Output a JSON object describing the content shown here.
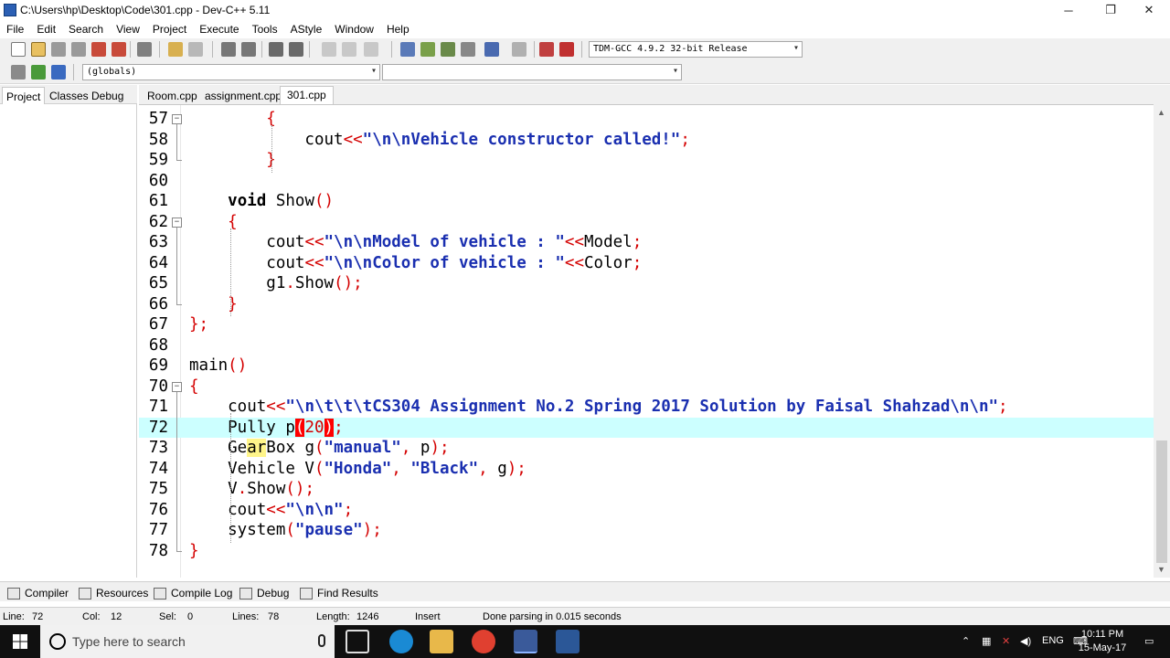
{
  "window": {
    "title": "C:\\Users\\hp\\Desktop\\Code\\301.cpp - Dev-C++ 5.11",
    "minimize_glyph": "─",
    "restore_glyph": "❐",
    "close_glyph": "✕"
  },
  "menu": [
    "File",
    "Edit",
    "Search",
    "View",
    "Project",
    "Execute",
    "Tools",
    "AStyle",
    "Window",
    "Help"
  ],
  "toolbar": {
    "compiler_select": "TDM-GCC 4.9.2 32-bit Release",
    "scope_select": "(globals)",
    "member_select": ""
  },
  "left_tabs": [
    "Project",
    "Classes",
    "Debug"
  ],
  "editor_tabs": [
    "Room.cpp",
    "assignment.cpp",
    "301.cpp"
  ],
  "code_lines": [
    {
      "num": "57",
      "fold": "⊟",
      "tokens": [
        {
          "t": "        ",
          "c": "plain"
        },
        {
          "t": "{",
          "c": "red"
        }
      ]
    },
    {
      "num": "58",
      "fold": "",
      "tokens": [
        {
          "t": "            cout",
          "c": "plain"
        },
        {
          "t": "<<",
          "c": "red"
        },
        {
          "t": "\"\\n\\nVehicle constructor called!\"",
          "c": "blue"
        },
        {
          "t": ";",
          "c": "red"
        }
      ]
    },
    {
      "num": "59",
      "fold": "",
      "tokens": [
        {
          "t": "        ",
          "c": "plain"
        },
        {
          "t": "}",
          "c": "red"
        }
      ]
    },
    {
      "num": "60",
      "fold": "",
      "tokens": []
    },
    {
      "num": "61",
      "fold": "",
      "tokens": [
        {
          "t": "    ",
          "c": "plain"
        },
        {
          "t": "void",
          "c": "kw"
        },
        {
          "t": " Show",
          "c": "plain"
        },
        {
          "t": "()",
          "c": "red"
        }
      ]
    },
    {
      "num": "62",
      "fold": "⊟",
      "tokens": [
        {
          "t": "    ",
          "c": "plain"
        },
        {
          "t": "{",
          "c": "red"
        }
      ]
    },
    {
      "num": "63",
      "fold": "",
      "tokens": [
        {
          "t": "        cout",
          "c": "plain"
        },
        {
          "t": "<<",
          "c": "red"
        },
        {
          "t": "\"\\n\\nModel of vehicle : \"",
          "c": "blue"
        },
        {
          "t": "<<",
          "c": "red"
        },
        {
          "t": "Model",
          "c": "plain"
        },
        {
          "t": ";",
          "c": "red"
        }
      ]
    },
    {
      "num": "64",
      "fold": "",
      "tokens": [
        {
          "t": "        cout",
          "c": "plain"
        },
        {
          "t": "<<",
          "c": "red"
        },
        {
          "t": "\"\\n\\nColor of vehicle : \"",
          "c": "blue"
        },
        {
          "t": "<<",
          "c": "red"
        },
        {
          "t": "Color",
          "c": "plain"
        },
        {
          "t": ";",
          "c": "red"
        }
      ]
    },
    {
      "num": "65",
      "fold": "",
      "tokens": [
        {
          "t": "        g1",
          "c": "plain"
        },
        {
          "t": ".",
          "c": "red"
        },
        {
          "t": "Show",
          "c": "plain"
        },
        {
          "t": "();",
          "c": "red"
        }
      ]
    },
    {
      "num": "66",
      "fold": "",
      "tokens": [
        {
          "t": "    ",
          "c": "plain"
        },
        {
          "t": "}",
          "c": "red"
        }
      ]
    },
    {
      "num": "67",
      "fold": "",
      "tokens": [
        {
          "t": "};",
          "c": "red"
        }
      ]
    },
    {
      "num": "68",
      "fold": "",
      "tokens": []
    },
    {
      "num": "69",
      "fold": "",
      "tokens": [
        {
          "t": "main",
          "c": "plain"
        },
        {
          "t": "()",
          "c": "red"
        }
      ]
    },
    {
      "num": "70",
      "fold": "⊟",
      "tokens": [
        {
          "t": "{",
          "c": "red"
        }
      ]
    },
    {
      "num": "71",
      "fold": "",
      "tokens": [
        {
          "t": "    cout",
          "c": "plain"
        },
        {
          "t": "<<",
          "c": "red"
        },
        {
          "t": "\"\\n\\t\\t\\tCS304 Assignment No.2 Spring 2017 Solution by Faisal Shahzad\\n\\n\"",
          "c": "blue"
        },
        {
          "t": ";",
          "c": "red"
        }
      ]
    },
    {
      "num": "72",
      "fold": "",
      "current": true,
      "tokens": [
        {
          "t": "    Pully p",
          "c": "plain"
        },
        {
          "t": "(",
          "c": "match"
        },
        {
          "t": "20",
          "c": "red"
        },
        {
          "t": ")",
          "c": "match"
        },
        {
          "t": ";",
          "c": "red"
        }
      ]
    },
    {
      "num": "73",
      "fold": "",
      "tokens": [
        {
          "t": "    Ge",
          "c": "plain"
        },
        {
          "t": "ar",
          "c": "hl"
        },
        {
          "t": "Box g",
          "c": "plain"
        },
        {
          "t": "(",
          "c": "red"
        },
        {
          "t": "\"manual\"",
          "c": "blue"
        },
        {
          "t": ", ",
          "c": "red"
        },
        {
          "t": "p",
          "c": "plain"
        },
        {
          "t": ");",
          "c": "red"
        }
      ]
    },
    {
      "num": "74",
      "fold": "",
      "tokens": [
        {
          "t": "    Vehicle V",
          "c": "plain"
        },
        {
          "t": "(",
          "c": "red"
        },
        {
          "t": "\"Honda\"",
          "c": "blue"
        },
        {
          "t": ", ",
          "c": "red"
        },
        {
          "t": "\"Black\"",
          "c": "blue"
        },
        {
          "t": ", ",
          "c": "red"
        },
        {
          "t": "g",
          "c": "plain"
        },
        {
          "t": ");",
          "c": "red"
        }
      ]
    },
    {
      "num": "75",
      "fold": "",
      "tokens": [
        {
          "t": "    V",
          "c": "plain"
        },
        {
          "t": ".",
          "c": "red"
        },
        {
          "t": "Show",
          "c": "plain"
        },
        {
          "t": "();",
          "c": "red"
        }
      ]
    },
    {
      "num": "76",
      "fold": "",
      "tokens": [
        {
          "t": "    cout",
          "c": "plain"
        },
        {
          "t": "<<",
          "c": "red"
        },
        {
          "t": "\"\\n\\n\"",
          "c": "blue"
        },
        {
          "t": ";",
          "c": "red"
        }
      ]
    },
    {
      "num": "77",
      "fold": "",
      "tokens": [
        {
          "t": "    system",
          "c": "plain"
        },
        {
          "t": "(",
          "c": "red"
        },
        {
          "t": "\"pause\"",
          "c": "blue"
        },
        {
          "t": ");",
          "c": "red"
        }
      ]
    },
    {
      "num": "78",
      "fold": "",
      "tokens": [
        {
          "t": "}",
          "c": "red"
        }
      ]
    }
  ],
  "bottom_tabs": [
    "Compiler",
    "Resources",
    "Compile Log",
    "Debug",
    "Find Results"
  ],
  "status": {
    "line_label": "Line:",
    "line_value": "72",
    "col_label": "Col:",
    "col_value": "12",
    "sel_label": "Sel:",
    "sel_value": "0",
    "lines_label": "Lines:",
    "lines_value": "78",
    "length_label": "Length:",
    "length_value": "1246",
    "mode": "Insert",
    "message": "Done parsing in 0.015 seconds"
  },
  "taskbar": {
    "search_placeholder": "Type here to search",
    "language": "ENG",
    "time": "10:11 PM",
    "date": "15-May-17"
  },
  "colors": {
    "string_blue": "#1a2fb0",
    "symbol_red": "#d40000",
    "current_line": "#ccffff",
    "brace_match": "#ff0000"
  }
}
